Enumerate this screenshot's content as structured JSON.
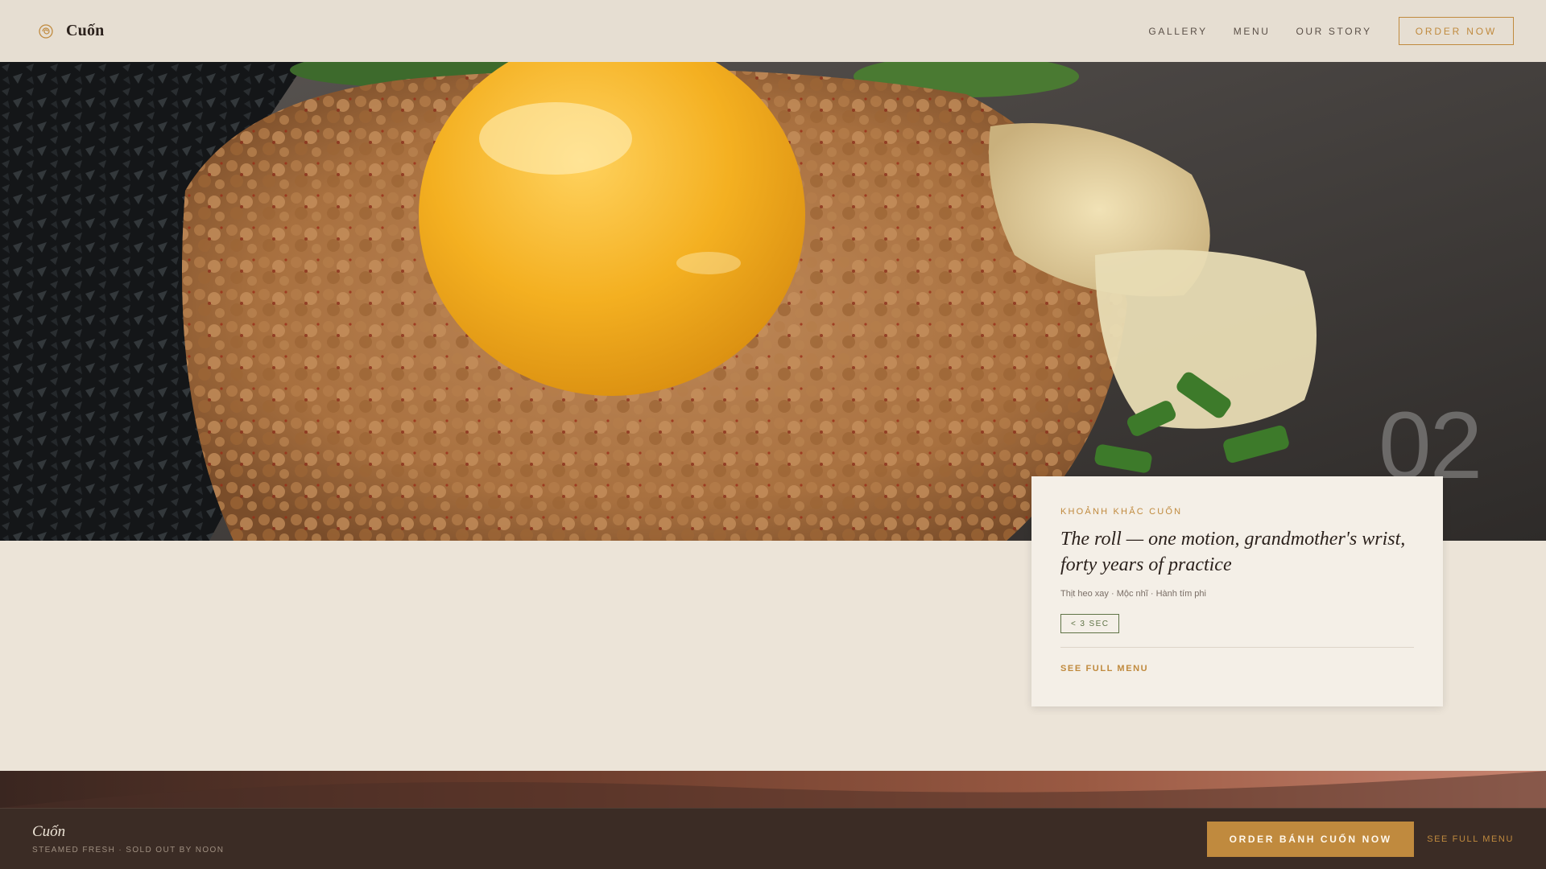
{
  "header": {
    "brand_name": "Cuốn",
    "brand_icon": "spiral-roll-icon",
    "nav": [
      {
        "label": "GALLERY"
      },
      {
        "label": "MENU"
      },
      {
        "label": "OUR STORY"
      }
    ],
    "order_label": "ORDER NOW"
  },
  "hero": {
    "image": "minced-pork-egg-yolk-photo",
    "slide_number": "02"
  },
  "card": {
    "eyebrow": "KHOẢNH KHẮC CUỐN",
    "title": "The roll — one motion, grandmother's wrist, forty years of practice",
    "ingredients": "Thịt heo xay · Mộc nhĩ · Hành tím phi",
    "badge": "< 3 SEC",
    "link": "SEE FULL MENU"
  },
  "bottom_bar": {
    "brand_name": "Cuốn",
    "tagline": "STEAMED FRESH · SOLD OUT BY NOON",
    "order_label": "ORDER BÁNH CUỐN NOW",
    "menu_link": "SEE FULL MENU"
  },
  "colors": {
    "accent": "#c08a3e",
    "background": "#ece4d8",
    "dark": "#3b2c25",
    "badge_green": "#5f7346"
  }
}
